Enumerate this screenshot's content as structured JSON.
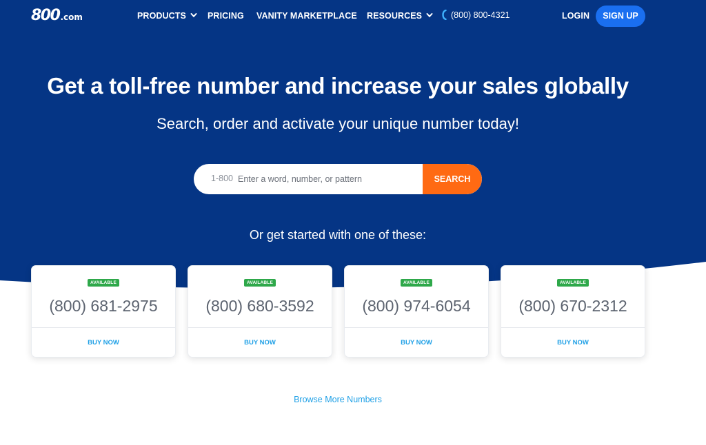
{
  "header": {
    "logo_main": "800",
    "logo_suffix": ".com",
    "nav": {
      "products": "PRODUCTS",
      "pricing": "PRICING",
      "vanity": "VANITY MARKETPLACE",
      "resources": "RESOURCES"
    },
    "phone": "(800) 800-4321",
    "login": "LOGIN",
    "signup": "SIGN UP"
  },
  "hero": {
    "headline": "Get a toll-free number and increase your sales globally",
    "subhead": "Search, order and activate your unique number today!",
    "search": {
      "prefix": "1-800",
      "placeholder": "Enter a word, number, or pattern",
      "value": "",
      "button": "SEARCH"
    },
    "started": "Or get started with one of these:"
  },
  "cards": [
    {
      "badge": "AVAILABLE",
      "number": "(800) 681-2975",
      "buy": "BUY NOW"
    },
    {
      "badge": "AVAILABLE",
      "number": "(800) 680-3592",
      "buy": "BUY NOW"
    },
    {
      "badge": "AVAILABLE",
      "number": "(800) 974-6054",
      "buy": "BUY NOW"
    },
    {
      "badge": "AVAILABLE",
      "number": "(800) 670-2312",
      "buy": "BUY NOW"
    }
  ],
  "browse": "Browse More Numbers",
  "colors": {
    "hero_bg": "#053585",
    "accent_blue": "#1a6ff0",
    "search_orange": "#ff6a13",
    "available_green": "#2ea84a",
    "link_blue": "#1fa0e6"
  },
  "icons": [
    "chevron-down-icon",
    "phone-icon"
  ]
}
